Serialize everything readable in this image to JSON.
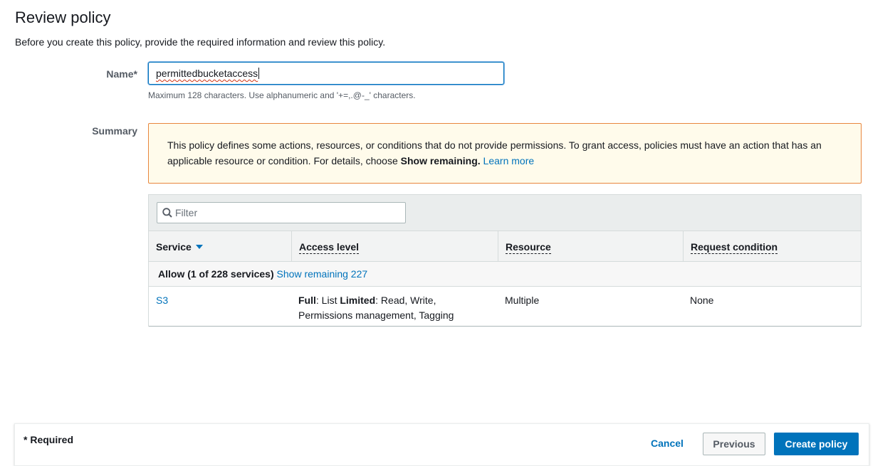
{
  "header": {
    "title": "Review policy",
    "description": "Before you create this policy, provide the required information and review this policy."
  },
  "name_field": {
    "label": "Name*",
    "value": "permittedbucketaccess",
    "hint": "Maximum 128 characters. Use alphanumeric and '+=,.@-_' characters."
  },
  "summary": {
    "label": "Summary",
    "warning": {
      "text_before": "This policy defines some actions, resources, or conditions that do not provide permissions. To grant access, policies must have an action that has an applicable resource or condition. For details, choose ",
      "bold": "Show remaining.",
      "link": "Learn more"
    },
    "filter_placeholder": "Filter",
    "columns": [
      "Service",
      "Access level",
      "Resource",
      "Request condition"
    ],
    "group": {
      "label": "Allow (1 of 228 services)",
      "link": "Show remaining 227"
    },
    "rows": [
      {
        "service": "S3",
        "access_full_label": "Full",
        "access_full_value": ": List ",
        "access_limited_label": "Limited",
        "access_limited_value": ": Read, Write, Permissions management, Tagging",
        "resource": "Multiple",
        "request_condition": "None"
      }
    ]
  },
  "footer": {
    "required_note": "* Required",
    "cancel": "Cancel",
    "previous": "Previous",
    "create": "Create policy"
  },
  "colors": {
    "link": "#0073bb",
    "warning_border": "#e8863e",
    "warning_bg": "#fffbeb",
    "primary_button": "#0073bb"
  }
}
